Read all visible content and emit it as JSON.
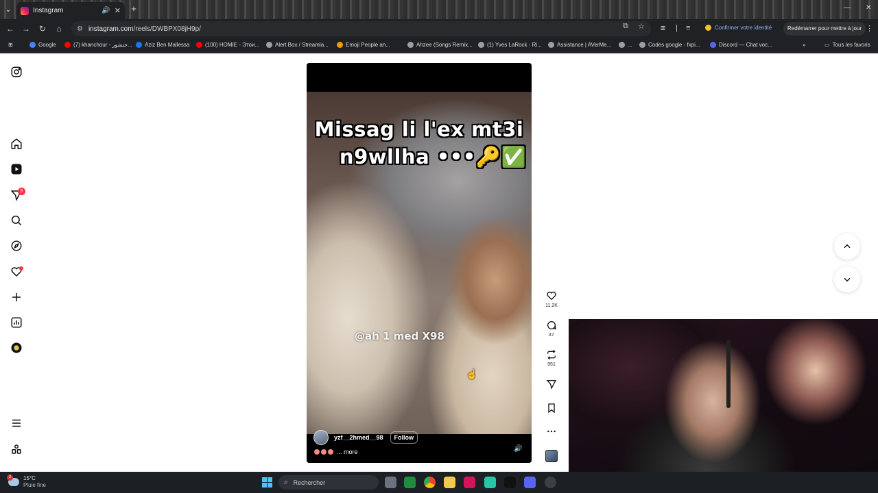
{
  "browser": {
    "tab_title": "Instagram",
    "url_domain": "instagram.com",
    "url_path": "/reels/DWBPX08jH9p/",
    "identity_text": "Confirmer votre identité",
    "restart_text": "Redémarrer pour mettre à jour",
    "bookmarks": [
      "Google",
      "(7) khanchour - خنشور...",
      "Aziz Ben Mallessa",
      "(100) HOMIE - Этои...",
      "Alert Box / Streamla...",
      "Emoji People an...",
      "Ahzee (Songs Remix...",
      "(1) Yves LaRock - Ri...",
      "Assistance | AVerMe...",
      "...",
      "Codes google - fxpi...",
      "Discord — Chat voc..."
    ],
    "all_favorites": "Tous les favoris"
  },
  "instagram": {
    "notification_badge": "5",
    "reel": {
      "caption_line1": "Missag li l'ex mt3i",
      "caption_line2": "n9wllha •••🔑✅",
      "overlay_tag": "@ah 1 med X98",
      "username": "yzf__2hmed__98",
      "follow_label": "Follow",
      "more_label": "... more"
    },
    "actions": {
      "likes": "11.2K",
      "comments": "47",
      "reposts": "951"
    }
  },
  "taskbar": {
    "weather_badge": "2",
    "temperature": "15°C",
    "weather_desc": "Pluie fine",
    "search_placeholder": "Rechercher"
  }
}
